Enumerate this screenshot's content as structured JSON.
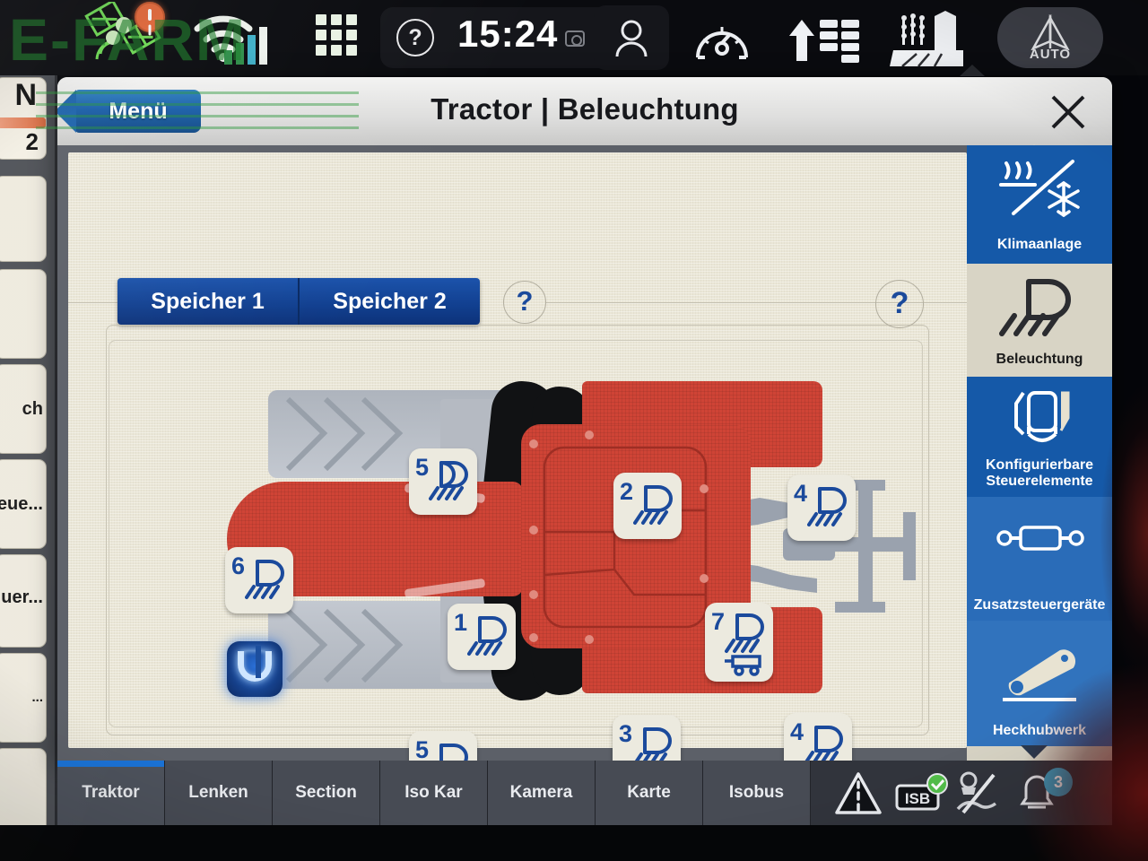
{
  "watermark": {
    "text": "E-FARM"
  },
  "statusbar": {
    "satellite_icon": "satellite-icon",
    "warning_icon": "warning-badge-icon",
    "wifi_icon": "wifi-icon",
    "signal_icon": "signal-bars-icon",
    "apps_icon": "app-grid-icon",
    "help_label": "?",
    "clock": "15:24",
    "camera_icon": "camera-icon",
    "user_icon": "user-profile-icon",
    "speedometer_icon": "speedometer-icon",
    "transfer_icon": "data-transfer-icon",
    "farm_icon": "farm-field-icon",
    "auto_label": "AUTO",
    "auto_icon": "auto-steer-icon"
  },
  "dialog": {
    "menu_button": "Menü",
    "title": "Tractor | Beleuchtung",
    "close_icon": "close-icon",
    "tabs": [
      {
        "label": "Speicher 1",
        "selected": true
      },
      {
        "label": "Speicher 2",
        "selected": false
      }
    ],
    "tab_help": "?",
    "body_help": "?"
  },
  "lights": [
    {
      "number": "1",
      "name": "front-work-light",
      "icon": "work-light-icon"
    },
    {
      "number": "2",
      "name": "cab-roof-front-light",
      "icon": "work-light-icon"
    },
    {
      "number": "3",
      "name": "cab-roof-rear-light",
      "icon": "work-light-icon"
    },
    {
      "number": "4",
      "name": "rear-right-work-light",
      "icon": "work-light-icon"
    },
    {
      "number": "4",
      "name": "rear-left-work-light",
      "icon": "work-light-icon"
    },
    {
      "number": "5",
      "name": "fender-left-light",
      "icon": "work-light-icon"
    },
    {
      "number": "5",
      "name": "fender-right-light",
      "icon": "work-light-icon"
    },
    {
      "number": "6",
      "name": "front-fender-light",
      "icon": "work-light-icon"
    },
    {
      "number": "7",
      "name": "trailer-work-light",
      "icon": "work-light-trailer-icon"
    }
  ],
  "sidemenu": [
    {
      "label": "Klimaanlage",
      "icon": "climate-control-icon",
      "state": "selected"
    },
    {
      "label": "Beleuchtung",
      "icon": "lighting-icon",
      "state": "active"
    },
    {
      "label": "Konfigurierbare Steuerelemente",
      "icon": "configurable-controls-icon",
      "state": "selected"
    },
    {
      "label": "Zusatzsteuergeräte",
      "icon": "auxiliary-valve-icon",
      "state": "selected"
    },
    {
      "label": "Heckhubwerk",
      "icon": "rear-linkage-icon",
      "state": "selected"
    }
  ],
  "bottombar": {
    "tabs": [
      {
        "label": "Traktor",
        "active": true
      },
      {
        "label": "Lenken",
        "active": false
      },
      {
        "label": "Section",
        "active": false
      },
      {
        "label": "Iso Kar",
        "active": false
      },
      {
        "label": "Kamera",
        "active": false
      },
      {
        "label": "Karte",
        "active": false
      },
      {
        "label": "Isobus",
        "active": false
      }
    ],
    "status_icons": [
      {
        "name": "guidance-line-icon"
      },
      {
        "name": "isb-icon",
        "label": "ISB"
      },
      {
        "name": "implement-disabled-icon"
      }
    ],
    "notification_count": "3",
    "bell_icon": "notification-bell-icon"
  },
  "leftpanel": {
    "items": [
      {
        "text": "N",
        "text2": "2"
      },
      {
        "text": ""
      },
      {
        "text": ""
      },
      {
        "text": "ch"
      },
      {
        "text": "eue..."
      },
      {
        "text": "uer..."
      },
      {
        "text": "..."
      },
      {
        "text": ""
      }
    ]
  },
  "colors": {
    "accent_blue": "#1559a8",
    "tab_blue": "#113f8f",
    "tractor_red": "#cf4436",
    "panel_cream": "#eae6d6",
    "bar_dark": "#31343c",
    "badge_teal": "#3fa3c7",
    "warning_orange": "#e7693a"
  }
}
